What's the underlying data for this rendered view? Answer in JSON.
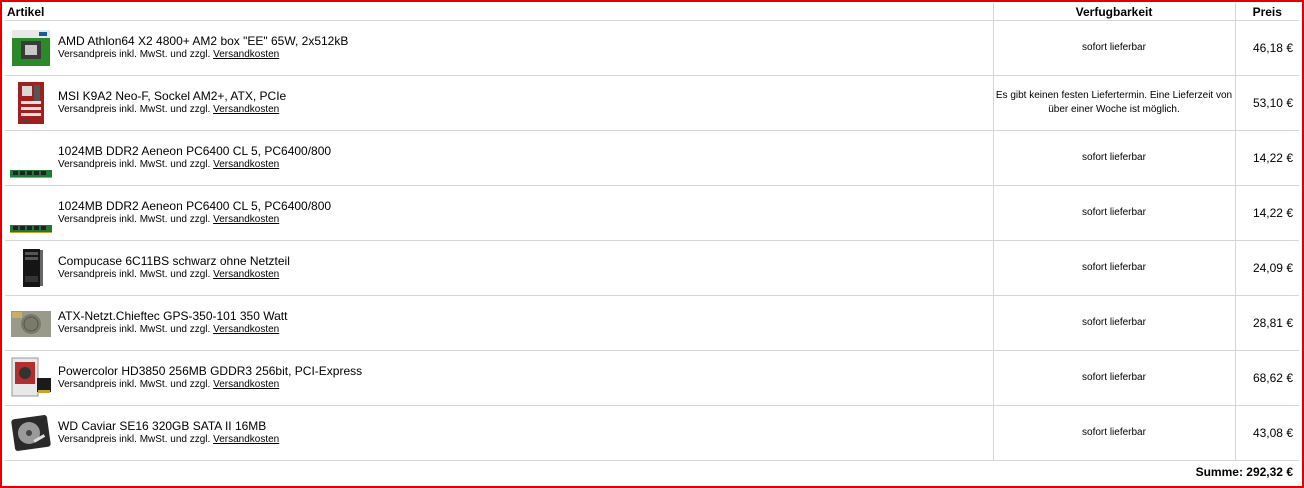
{
  "header": {
    "artikel": "Artikel",
    "verfugbarkeit": "Verfugbarkeit",
    "preis": "Preis"
  },
  "sub_prefix": "Versandpreis inkl. MwSt. und zzgl.",
  "sub_link": "Versandkosten",
  "items": [
    {
      "title": "AMD Athlon64 X2 4800+ AM2 box \"EE\" 65W, 2x512kB",
      "availability": "sofort lieferbar",
      "price": "46,18 €",
      "icon": "cpu-box-icon"
    },
    {
      "title": "MSI K9A2 Neo-F, Sockel AM2+, ATX, PCIe",
      "availability": "Es gibt keinen festen Liefertermin. Eine Lieferzeit von über einer Woche ist möglich.",
      "price": "53,10 €",
      "icon": "motherboard-icon"
    },
    {
      "title": "1024MB DDR2 Aeneon PC6400 CL 5, PC6400/800",
      "availability": "sofort lieferbar",
      "price": "14,22 €",
      "icon": "ram-module-icon"
    },
    {
      "title": "1024MB DDR2 Aeneon PC6400 CL 5, PC6400/800",
      "availability": "sofort lieferbar",
      "price": "14,22 €",
      "icon": "ram-module-icon"
    },
    {
      "title": "Compucase 6C11BS schwarz ohne Netzteil",
      "availability": "sofort lieferbar",
      "price": "24,09 €",
      "icon": "pc-case-icon"
    },
    {
      "title": "ATX-Netzt.Chieftec GPS-350-101 350 Watt",
      "availability": "sofort lieferbar",
      "price": "28,81 €",
      "icon": "power-supply-icon"
    },
    {
      "title": "Powercolor HD3850 256MB GDDR3 256bit, PCI-Express",
      "availability": "sofort lieferbar",
      "price": "68,62 €",
      "icon": "graphics-card-icon"
    },
    {
      "title": "WD Caviar SE16 320GB SATA II 16MB",
      "availability": "sofort lieferbar",
      "price": "43,08 €",
      "icon": "hard-drive-icon"
    }
  ],
  "summe": {
    "label": "Summe:",
    "value": "292,32 €"
  },
  "colors": {
    "frame": "#e00000",
    "grid": "#d6d6d6"
  }
}
